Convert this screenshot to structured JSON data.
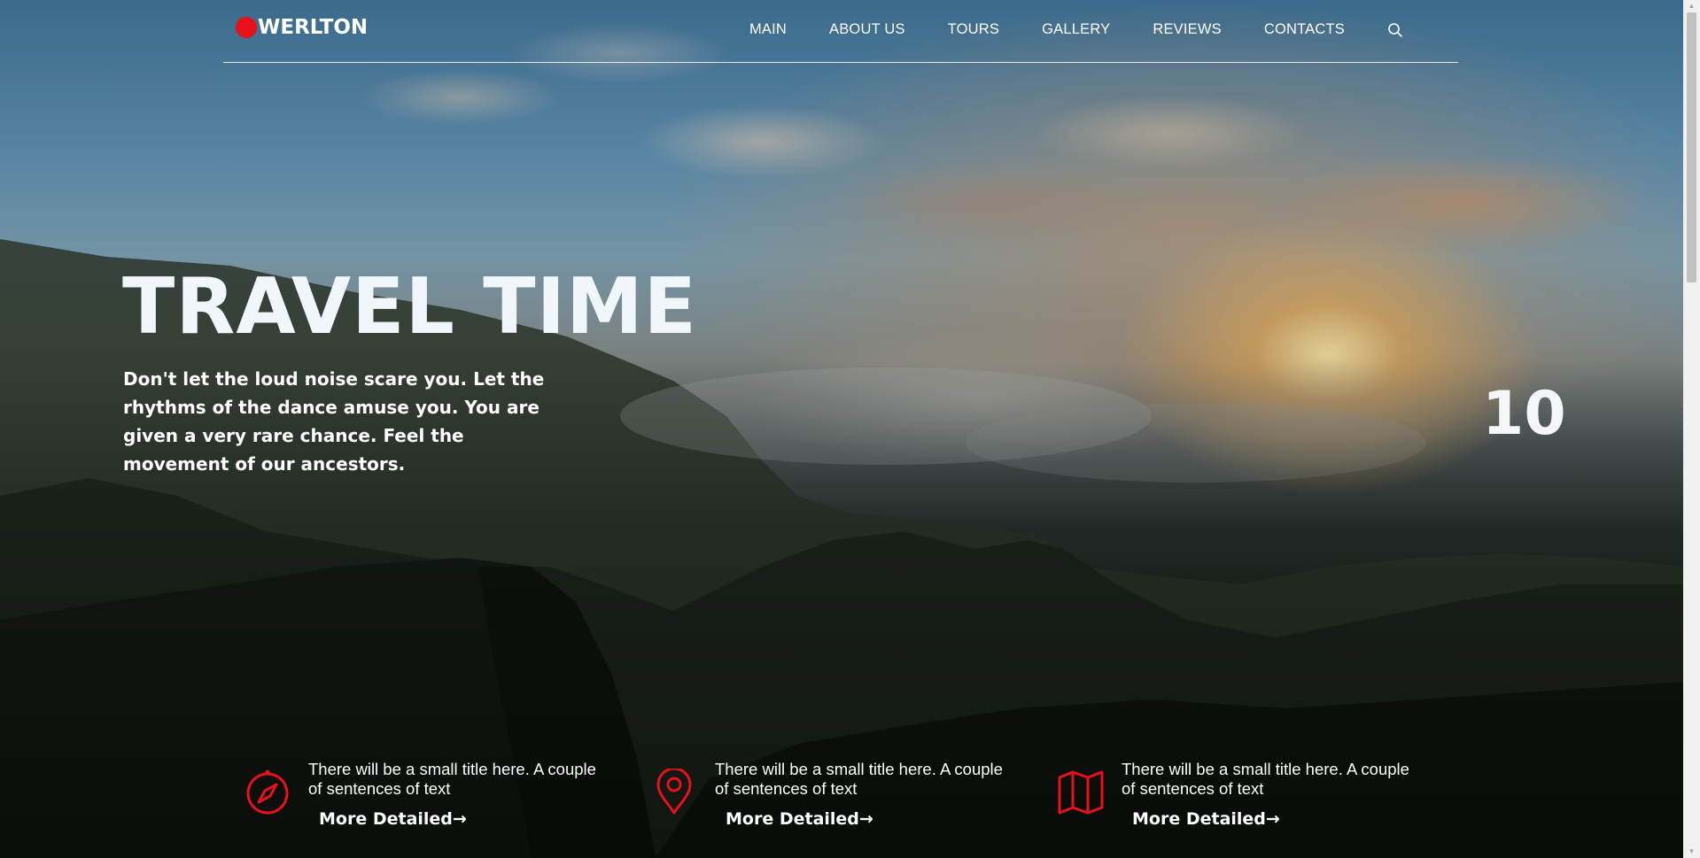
{
  "brand": {
    "name": "WERLTON",
    "accent_color": "#e8101a"
  },
  "nav": {
    "items": [
      {
        "label": "MAIN"
      },
      {
        "label": "ABOUT US"
      },
      {
        "label": "TOURS"
      },
      {
        "label": "GALLERY"
      },
      {
        "label": "REVIEWS"
      },
      {
        "label": "CONTACTS"
      }
    ],
    "search_icon": "search-icon"
  },
  "hero": {
    "title": "TRAVEL TIME",
    "text": "Don't let the loud noise scare you. Let the rhythms of the dance amuse you. You are given a very rare chance. Feel the movement of our ancestors.",
    "slide_number": "10"
  },
  "features": [
    {
      "icon": "compass-icon",
      "text": "There will be a small title here. A couple of sentences of text",
      "link": "More Detailed→"
    },
    {
      "icon": "location-pin-icon",
      "text": "There will be a small title here. A couple of sentences of text",
      "link": "More Detailed→"
    },
    {
      "icon": "map-icon",
      "text": "There will be a small title here. A couple of sentences of text",
      "link": "More Detailed→"
    }
  ]
}
